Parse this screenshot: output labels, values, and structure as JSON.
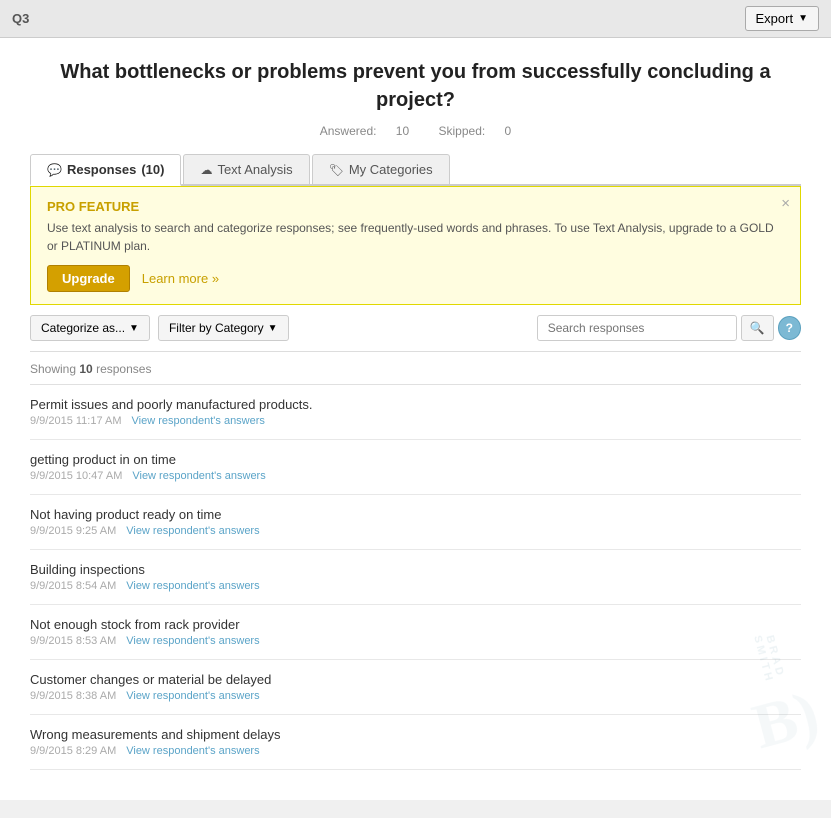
{
  "header": {
    "q_label": "Q3",
    "export_label": "Export"
  },
  "question": {
    "title": "What bottlenecks or problems prevent you from successfully concluding a project?",
    "answered_label": "Answered:",
    "answered_value": "10",
    "skipped_label": "Skipped:",
    "skipped_value": "0"
  },
  "tabs": [
    {
      "id": "responses",
      "label": "Responses",
      "count": "(10)",
      "icon": "💬",
      "active": true
    },
    {
      "id": "text-analysis",
      "label": "Text Analysis",
      "icon": "☁",
      "active": false
    },
    {
      "id": "my-categories",
      "label": "My Categories",
      "icon": "🏷",
      "active": false
    }
  ],
  "pro_banner": {
    "title": "PRO FEATURE",
    "description": "Use text analysis to search and categorize responses; see frequently-used words and phrases. To use Text Analysis, upgrade to a GOLD or PLATINUM plan.",
    "upgrade_label": "Upgrade",
    "learn_more_label": "Learn more »",
    "close_label": "×"
  },
  "filters": {
    "categorize_label": "Categorize as...",
    "filter_label": "Filter by Category",
    "search_placeholder": "Search responses",
    "search_btn_icon": "🔍",
    "help_label": "?"
  },
  "showing": {
    "prefix": "Showing",
    "count": "10",
    "suffix": "responses"
  },
  "responses": [
    {
      "text": "Permit issues and poorly manufactured products.",
      "date": "9/9/2015 11:17 AM",
      "view_label": "View respondent's answers"
    },
    {
      "text": "getting product in on time",
      "date": "9/9/2015 10:47 AM",
      "view_label": "View respondent's answers"
    },
    {
      "text": "Not having product ready on time",
      "date": "9/9/2015 9:25 AM",
      "view_label": "View respondent's answers"
    },
    {
      "text": "Building inspections",
      "date": "9/9/2015 8:54 AM",
      "view_label": "View respondent's answers"
    },
    {
      "text": "Not enough stock from rack provider",
      "date": "9/9/2015 8:53 AM",
      "view_label": "View respondent's answers"
    },
    {
      "text": "Customer changes or material be delayed",
      "date": "9/9/2015 8:38 AM",
      "view_label": "View respondent's answers"
    },
    {
      "text": "Wrong measurements and shipment delays",
      "date": "9/9/2015 8:29 AM",
      "view_label": "View respondent's answers"
    }
  ],
  "colors": {
    "accent": "#5ba4c8",
    "pro_title": "#c8a000",
    "tab_active_bg": "#ffffff"
  }
}
